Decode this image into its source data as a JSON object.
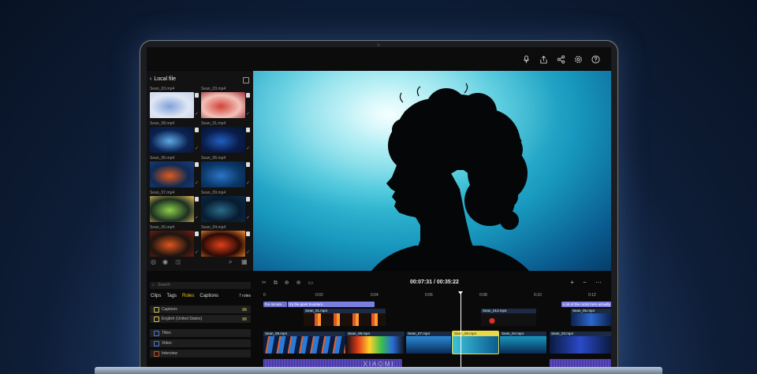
{
  "brand": "XIAOMI",
  "top_icons": [
    "microphone-icon",
    "share-upload-icon",
    "share-icon",
    "settings-icon",
    "help-icon"
  ],
  "left_panel": {
    "title": "Local file",
    "files": [
      {
        "name": "Sean_03.mp4",
        "colors": [
          "#dfe7f5",
          "#7fa2d8",
          "#c8d2e8"
        ]
      },
      {
        "name": "Sean_03.mp4",
        "colors": [
          "#f2c2b8",
          "#d2423a",
          "#9e2f3c"
        ]
      },
      {
        "name": "Sean_08.mp4",
        "colors": [
          "#0b2250",
          "#5fa9e8",
          "#0a1530"
        ]
      },
      {
        "name": "Sean_01.mp4",
        "colors": [
          "#0a1c4a",
          "#1f5fc0",
          "#06122c"
        ]
      },
      {
        "name": "Sean_06.mp4",
        "colors": [
          "#0f2a55",
          "#e05a1c",
          "#1a3f7a"
        ]
      },
      {
        "name": "Sean_06.mp4",
        "colors": [
          "#0b3a6a",
          "#2b76c8",
          "#081f44"
        ]
      },
      {
        "name": "Sean_07.mp4",
        "colors": [
          "#1c2f22",
          "#8ccf4a",
          "#e6c25a"
        ]
      },
      {
        "name": "Sean_09.mp4",
        "colors": [
          "#081c30",
          "#2a6a8a",
          "#0a2a44"
        ]
      },
      {
        "name": "Sean_06.mp4",
        "colors": [
          "#1c1410",
          "#e0551e",
          "#7a1f10"
        ]
      },
      {
        "name": "Sean_04.mp4",
        "colors": [
          "#2a0a05",
          "#e0401a",
          "#ff8a2a"
        ]
      }
    ],
    "tools": [
      "check-circle-icon",
      "sparkle-icon",
      "trash-icon",
      "search-icon",
      "grid-icon"
    ]
  },
  "timecode": "00:07:31 / 00:35:22",
  "timeline_tools": [
    "cut-icon",
    "copy-icon",
    "add-icon",
    "add-icon",
    "delete-icon"
  ],
  "zoom_controls": [
    "+",
    "−",
    "⋯"
  ],
  "roles_panel": {
    "search_placeholder": "Search",
    "tabs": [
      "Clips",
      "Tags",
      "Roles",
      "Captions"
    ],
    "active_tab": "Roles",
    "role_count": "7 roles",
    "roles": [
      {
        "label": "Captions",
        "color": "#d6c24a"
      },
      {
        "label": "English (United States)",
        "color": "#d6c24a"
      },
      {
        "label": "Titles",
        "color": "#4a7ad6"
      },
      {
        "label": "Video",
        "color": "#4a7ad6"
      },
      {
        "label": "Interview",
        "color": "#c0562a"
      }
    ]
  },
  "ruler_ticks": [
    "0",
    "0:02",
    "0:04",
    "0:06",
    "0:08",
    "0:10",
    "0:12"
  ],
  "captions": [
    "the minute...",
    "try the giant boulders.",
    "a lot of the rocks here actually g"
  ],
  "clips_upper": [
    "Sean_01.mp4",
    "Sean_013.mp4",
    "Sean_05.mp4"
  ],
  "clips_main": [
    "Sean_09.mp4",
    "Sean_08.mp4",
    "Sean_07.mp4",
    "Sean_06.mp4",
    "Sean_04.mp4",
    "Sean_03.mp4"
  ]
}
